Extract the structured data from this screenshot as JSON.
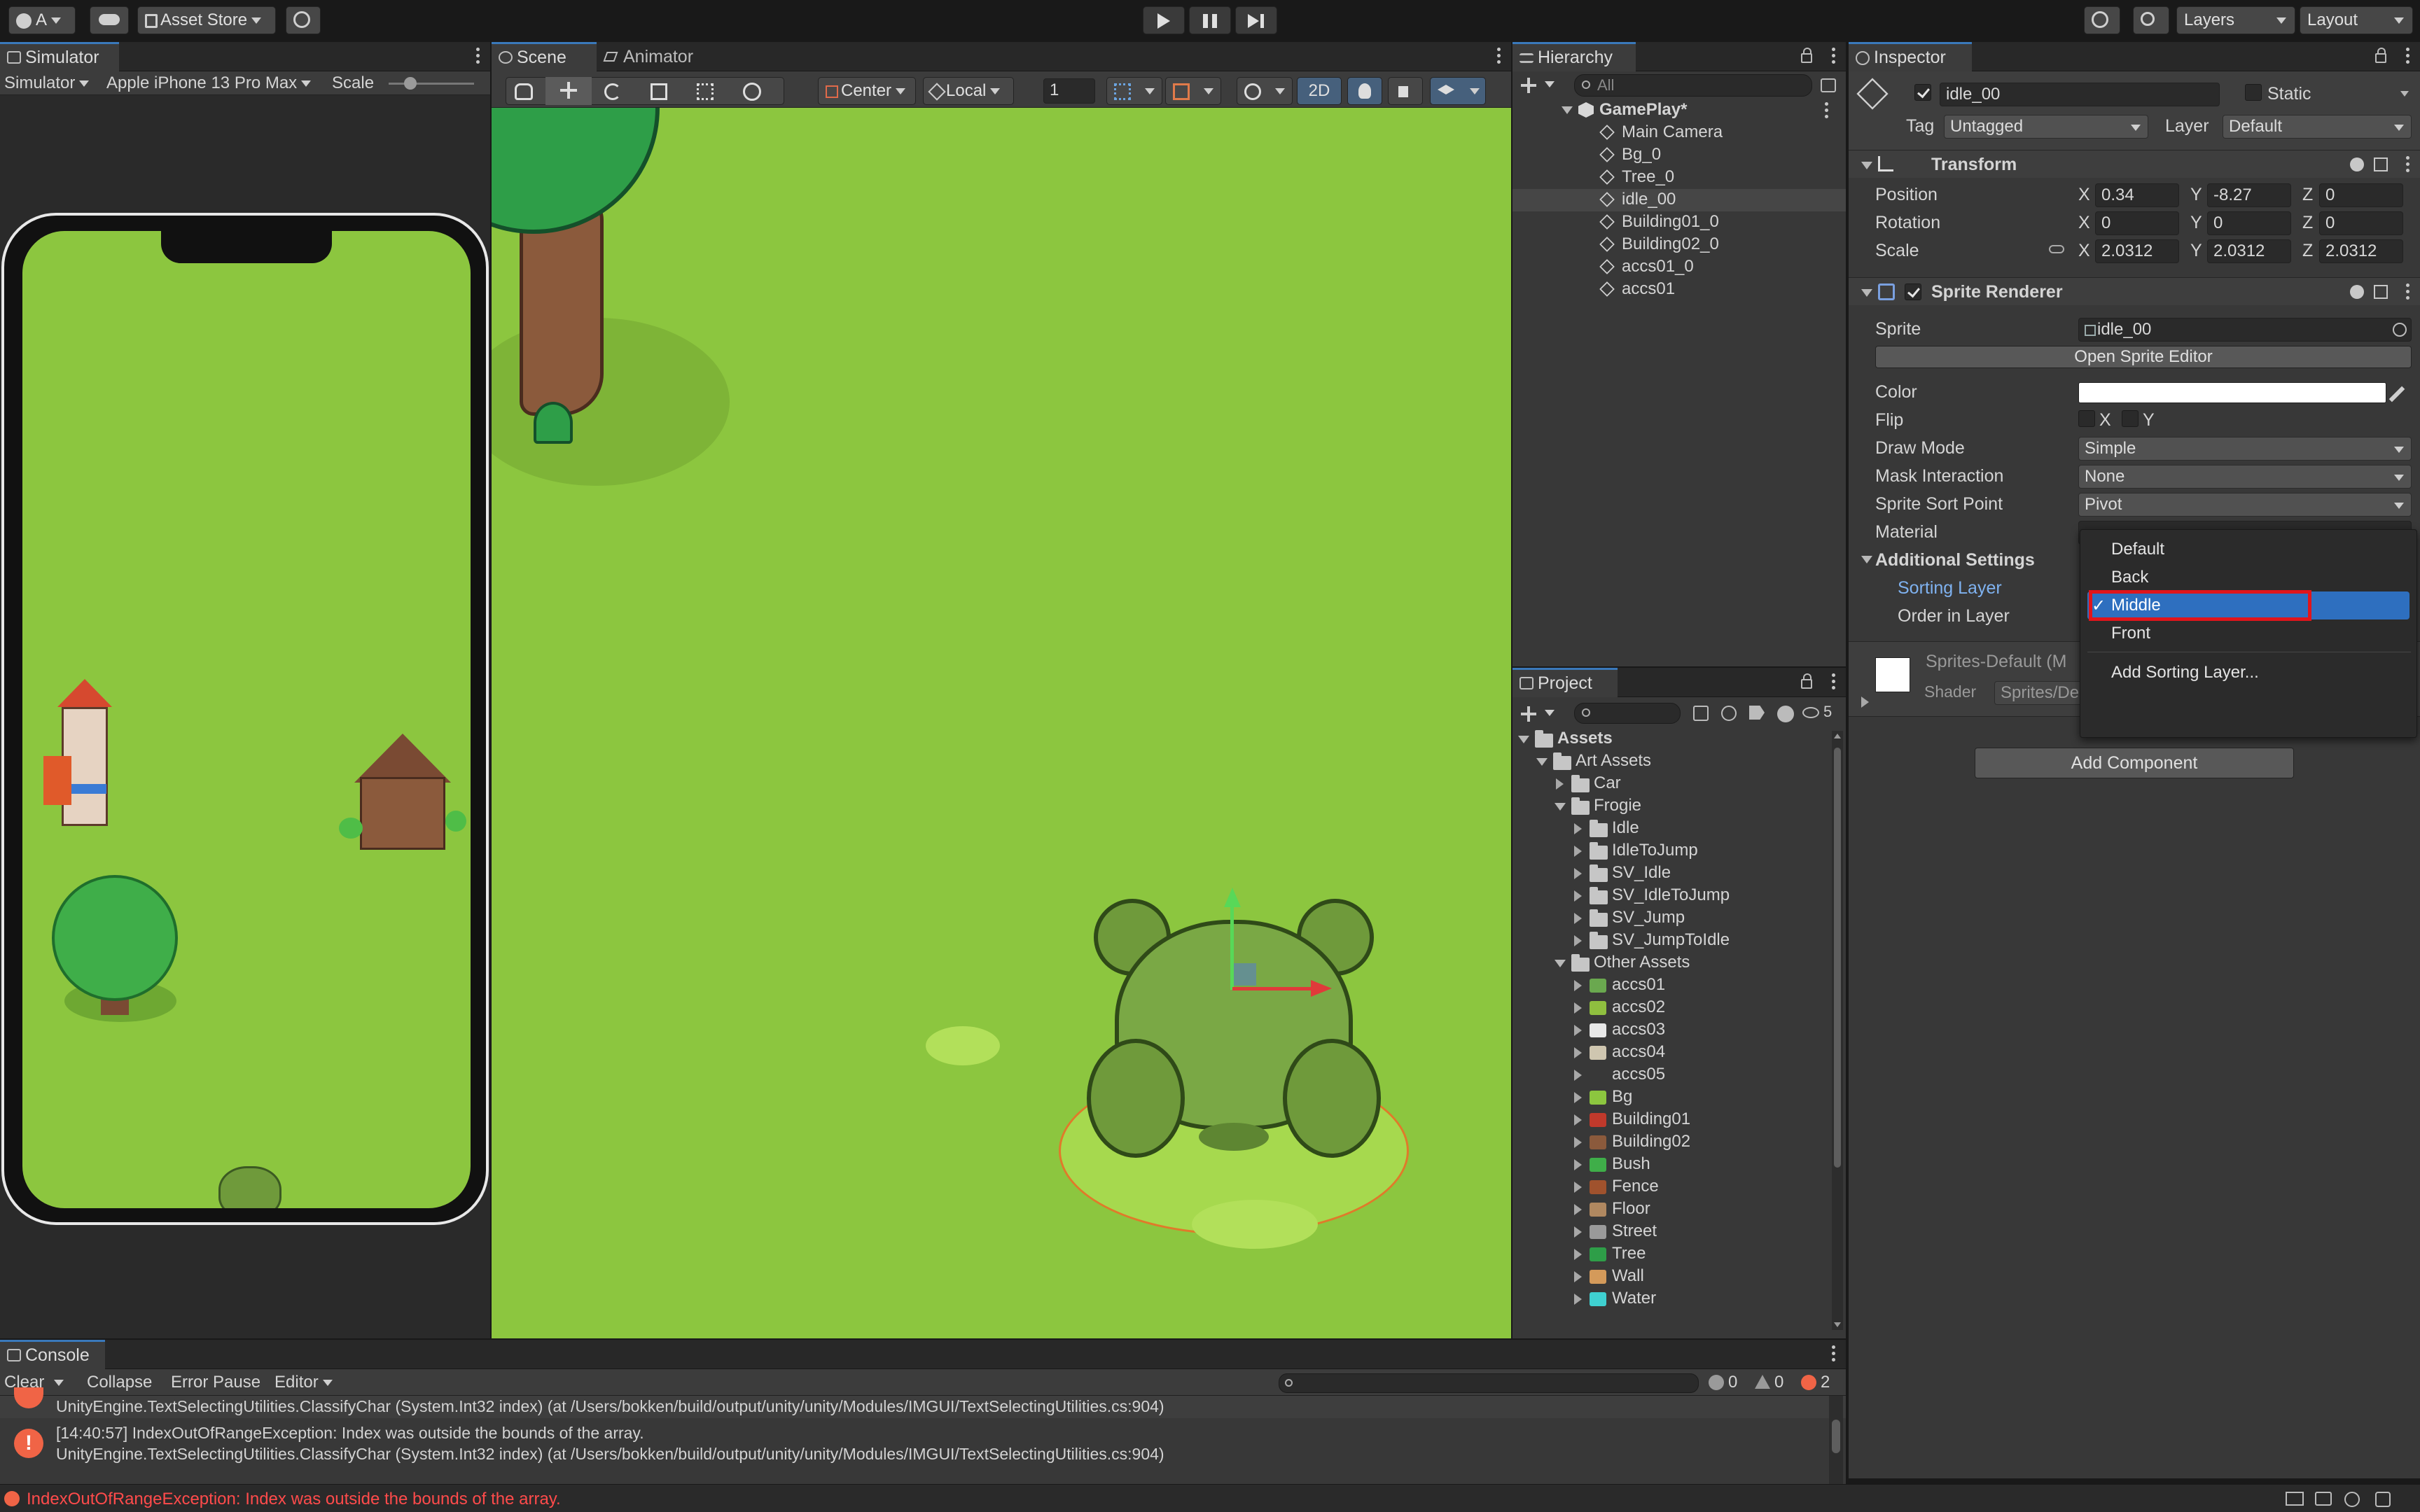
{
  "toolbar": {
    "account_label": "A",
    "asset_store_label": "Asset Store",
    "layers_label": "Layers",
    "layout_label": "Layout"
  },
  "simulator": {
    "tab_label": "Simulator",
    "mode_label": "Simulator",
    "device_label": "Apple iPhone 13 Pro Max",
    "scale_label": "Scale"
  },
  "scene": {
    "tab_label": "Scene",
    "animator_tab_label": "Animator",
    "pivot_label": "Center",
    "space_label": "Local",
    "snap_value": "1",
    "mode_2d_label": "2D"
  },
  "hierarchy": {
    "tab_label": "Hierarchy",
    "search_placeholder": "All",
    "scene_name": "GamePlay*",
    "items": [
      "Main Camera",
      "Bg_0",
      "Tree_0",
      "idle_00",
      "Building01_0",
      "Building02_0",
      "accs01_0",
      "accs01"
    ],
    "selected_index": 3
  },
  "project": {
    "tab_label": "Project",
    "badge_count": "5",
    "tree": [
      {
        "label": "Assets",
        "level": 0,
        "type": "folder",
        "expanded": true
      },
      {
        "label": "Art Assets",
        "level": 1,
        "type": "folder",
        "expanded": true
      },
      {
        "label": "Car",
        "level": 2,
        "type": "folder",
        "expanded": false
      },
      {
        "label": "Frogie",
        "level": 2,
        "type": "folder",
        "expanded": true
      },
      {
        "label": "Idle",
        "level": 3,
        "type": "folder",
        "expanded": false
      },
      {
        "label": "IdleToJump",
        "level": 3,
        "type": "folder",
        "expanded": false
      },
      {
        "label": "SV_Idle",
        "level": 3,
        "type": "folder",
        "expanded": false
      },
      {
        "label": "SV_IdleToJump",
        "level": 3,
        "type": "folder",
        "expanded": false
      },
      {
        "label": "SV_Jump",
        "level": 3,
        "type": "folder",
        "expanded": false
      },
      {
        "label": "SV_JumpToIdle",
        "level": 3,
        "type": "folder",
        "expanded": false
      },
      {
        "label": "Other Assets",
        "level": 2,
        "type": "folder",
        "expanded": true
      },
      {
        "label": "accs01",
        "level": 3,
        "type": "sprite",
        "color": "#6aa84f"
      },
      {
        "label": "accs02",
        "level": 3,
        "type": "sprite",
        "color": "#8fbf3f"
      },
      {
        "label": "accs03",
        "level": 3,
        "type": "sprite",
        "color": "#e8e8e8"
      },
      {
        "label": "accs04",
        "level": 3,
        "type": "sprite",
        "color": "#cfc6b0"
      },
      {
        "label": "accs05",
        "level": 3,
        "type": "sprite",
        "color": "#383838"
      },
      {
        "label": "Bg",
        "level": 3,
        "type": "sprite",
        "color": "#8cc63f"
      },
      {
        "label": "Building01",
        "level": 3,
        "type": "sprite",
        "color": "#c0392b"
      },
      {
        "label": "Building02",
        "level": 3,
        "type": "sprite",
        "color": "#8b5a3c"
      },
      {
        "label": "Bush",
        "level": 3,
        "type": "sprite",
        "color": "#3fae49"
      },
      {
        "label": "Fence",
        "level": 3,
        "type": "sprite",
        "color": "#a0522d"
      },
      {
        "label": "Floor",
        "level": 3,
        "type": "sprite",
        "color": "#b08860"
      },
      {
        "label": "Street",
        "level": 3,
        "type": "sprite",
        "color": "#9a9a9a"
      },
      {
        "label": "Tree",
        "level": 3,
        "type": "sprite",
        "color": "#2e9e48"
      },
      {
        "label": "Wall",
        "level": 3,
        "type": "sprite",
        "color": "#d49a5a"
      },
      {
        "label": "Water",
        "level": 3,
        "type": "sprite",
        "color": "#3fd0d0"
      }
    ]
  },
  "inspector": {
    "tab_label": "Inspector",
    "object_name": "idle_00",
    "static_label": "Static",
    "tag_label": "Tag",
    "tag_value": "Untagged",
    "layer_label": "Layer",
    "layer_value": "Default",
    "transform": {
      "title": "Transform",
      "position_label": "Position",
      "rotation_label": "Rotation",
      "scale_label": "Scale",
      "position": {
        "x": "0.34",
        "y": "-8.27",
        "z": "0"
      },
      "rotation": {
        "x": "0",
        "y": "0",
        "z": "0"
      },
      "scale": {
        "x": "2.0312",
        "y": "2.0312",
        "z": "2.0312"
      },
      "axis_x": "X",
      "axis_y": "Y",
      "axis_z": "Z"
    },
    "sprite_renderer": {
      "title": "Sprite Renderer",
      "sprite_label": "Sprite",
      "sprite_value": "idle_00",
      "open_editor_label": "Open Sprite Editor",
      "color_label": "Color",
      "color_value": "#ffffff",
      "flip_label": "Flip",
      "flip_x": "X",
      "flip_y": "Y",
      "draw_mode_label": "Draw Mode",
      "draw_mode_value": "Simple",
      "mask_label": "Mask Interaction",
      "mask_value": "None",
      "sort_point_label": "Sprite Sort Point",
      "sort_point_value": "Pivot",
      "material_label": "Material",
      "additional_label": "Additional Settings",
      "sorting_layer_label": "Sorting Layer",
      "order_label": "Order in Layer"
    },
    "material_name": "Sprites-Default (M",
    "shader_label": "Shader",
    "shader_value": "Sprites/De",
    "add_component_label": "Add Component"
  },
  "sorting_dropdown": {
    "options": [
      "Default",
      "Back",
      "Middle",
      "Front"
    ],
    "selected": "Middle",
    "checkmark": "✓",
    "add_label": "Add Sorting Layer..."
  },
  "console": {
    "tab_label": "Console",
    "clear_label": "Clear",
    "collapse_label": "Collapse",
    "error_pause_label": "Error Pause",
    "editor_label": "Editor",
    "count_log": "0",
    "count_warn": "0",
    "count_error": "2",
    "line_partial": "UnityEngine.TextSelectingUtilities.ClassifyChar (System.Int32 index) (at /Users/bokken/build/output/unity/unity/Modules/IMGUI/TextSelectingUtilities.cs:904)",
    "entry_line1": "[14:40:57] IndexOutOfRangeException: Index was outside the bounds of the array.",
    "entry_line2": "UnityEngine.TextSelectingUtilities.ClassifyChar (System.Int32 index) (at /Users/bokken/build/output/unity/unity/Modules/IMGUI/TextSelectingUtilities.cs:904)",
    "status_message": "IndexOutOfRangeException: Index was outside the bounds of the array.",
    "error_color": "#ff4b4b"
  },
  "colors": {
    "accent": "#3a79bb",
    "selection": "#2c5d87",
    "highlight_box": "#e0151b",
    "grass": "#8cc63f"
  }
}
